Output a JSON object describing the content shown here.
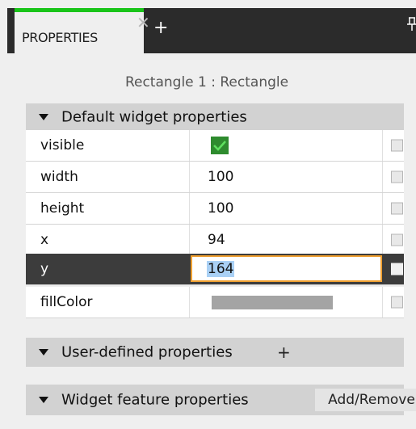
{
  "tab": {
    "label": "PROPERTIES",
    "close_glyph": "✕",
    "add_glyph": "+",
    "pin_icon": "pin-icon",
    "accent_color": "#19c419"
  },
  "subject": {
    "title": "Rectangle 1 : Rectangle"
  },
  "sections": {
    "default": {
      "label": "Default widget properties"
    },
    "user": {
      "label": "User-defined properties",
      "add_glyph": "+"
    },
    "feature": {
      "label": "Widget feature properties",
      "button": "Add/Remove"
    }
  },
  "properties": [
    {
      "name": "visible",
      "type": "checkbox",
      "checked": true
    },
    {
      "name": "width",
      "value": "100"
    },
    {
      "name": "height",
      "value": "100"
    },
    {
      "name": "x",
      "value": "94"
    },
    {
      "name": "y",
      "value": "164",
      "editing": true
    },
    {
      "name": "fillColor",
      "type": "color",
      "color": "#a4a4a4"
    }
  ],
  "colors": {
    "selected_row": "#3c3c3c",
    "edit_border": "#f0a030",
    "selection_highlight": "#a9d0f5",
    "check_green": "#2e8b2e"
  }
}
